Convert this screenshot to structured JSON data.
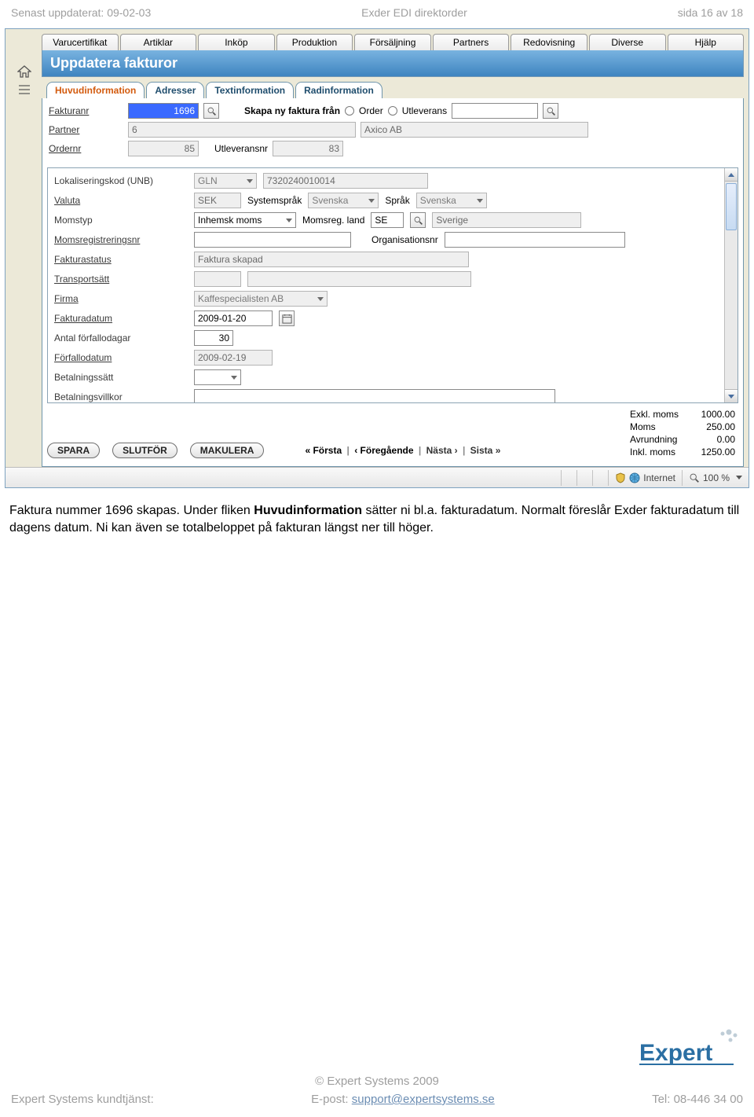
{
  "doc": {
    "updated": "Senast uppdaterat: 09-02-03",
    "title": "Exder EDI direktorder",
    "page": "sida 16 av 18",
    "copyright": "© Expert Systems 2009",
    "support_label": "Expert Systems kundtjänst:",
    "email_label": "E-post: ",
    "email": "support@expertsystems.se",
    "tel": "Tel: 08-446 34 00",
    "logo_name": "Expert"
  },
  "menubar": [
    "Varucertifikat",
    "Artiklar",
    "Inköp",
    "Produktion",
    "Försäljning",
    "Partners",
    "Redovisning",
    "Diverse",
    "Hjälp"
  ],
  "page_title": "Uppdatera fakturor",
  "sub_tabs": [
    "Huvudinformation",
    "Adresser",
    "Textinformation",
    "Radinformation"
  ],
  "top": {
    "fakturanr_label": "Fakturanr",
    "fakturanr_value": "1696",
    "skapa_label": "Skapa ny faktura från",
    "order_label": "Order",
    "utleverans_label": "Utleverans",
    "partner_label": "Partner",
    "partner_num": "6",
    "partner_name": "Axico AB",
    "ordernr_label": "Ordernr",
    "ordernr_value": "85",
    "utleveransnr_label": "Utleveransnr",
    "utleveransnr_value": "83"
  },
  "form": {
    "lokaliseringskod_label": "Lokaliseringskod (UNB)",
    "lok_type": "GLN",
    "lok_value": "7320240010014",
    "valuta_label": "Valuta",
    "valuta": "SEK",
    "systemsprak_label": "Systemspråk",
    "systemsprak": "Svenska",
    "sprak_label": "Språk",
    "sprak": "Svenska",
    "momstyp_label": "Momstyp",
    "momstyp": "Inhemsk moms",
    "momsreg_land_label": "Momsreg. land",
    "momsreg_land_code": "SE",
    "momsreg_land_name": "Sverige",
    "momsregnr_label": "Momsregistreringsnr",
    "orgnr_label": "Organisationsnr",
    "fakturastatus_label": "Fakturastatus",
    "fakturastatus": "Faktura skapad",
    "transport_label": "Transportsätt",
    "firma_label": "Firma",
    "firma": "Kaffespecialisten AB",
    "fakturadatum_label": "Fakturadatum",
    "fakturadatum": "2009-01-20",
    "forfallodagar_label": "Antal förfallodagar",
    "forfallodagar": "30",
    "forfallodatum_label": "Förfallodatum",
    "forfallodatum": "2009-02-19",
    "betalsatt_label": "Betalningssätt",
    "betalvillkor_label": "Betalningsvillkor"
  },
  "actions": {
    "spara": "SPARA",
    "slutfor": "SLUTFÖR",
    "makulera": "MAKULERA",
    "forsta": "« Första",
    "fore": "‹ Föregående",
    "nasta": "Nästa ›",
    "sista": "Sista »"
  },
  "totals": {
    "exkl_label": "Exkl. moms",
    "exkl": "1000.00",
    "moms_label": "Moms",
    "moms": "250.00",
    "avr_label": "Avrundning",
    "avr": "0.00",
    "inkl_label": "Inkl. moms",
    "inkl": "1250.00"
  },
  "status": {
    "internet": "Internet",
    "zoom": "100 %"
  },
  "body_text_1": "Faktura nummer 1696 skapas. Under fliken ",
  "body_text_bold": "Huvudinformation",
  "body_text_2": " sätter ni bl.a. fakturadatum. Normalt föreslår Exder fakturadatum till dagens datum. Ni kan även se totalbeloppet på fakturan längst ner till höger."
}
